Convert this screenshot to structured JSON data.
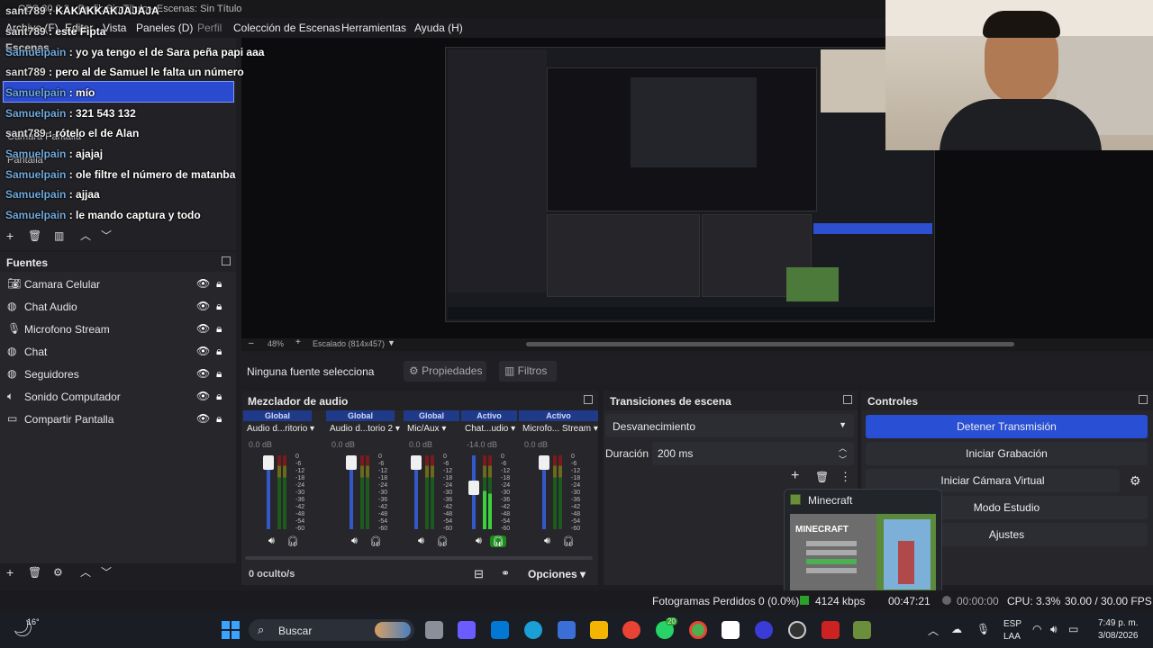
{
  "window": {
    "title": "OBS 30.2.3 - Perfil: Sin Título - Escenas: Sin Título"
  },
  "menu": [
    "Archivo (F)",
    "Editar",
    "Vista",
    "Paneles (D)",
    "Perfil",
    "Colección de Escenas",
    "Herramientas",
    "Ayuda (H)"
  ],
  "chat": [
    {
      "user": "sant789",
      "text": " : KAKAKKAKJAJAJA"
    },
    {
      "user": "sant789",
      "text": " : este Fipta"
    },
    {
      "user": "Samuelpain",
      "text": " : yo ya tengo el de Sara peña papi aaa"
    },
    {
      "user": "sant789",
      "text": " : pero al de Samuel le falta un número"
    },
    {
      "user": "Samuelpain",
      "text": " : mío"
    },
    {
      "user": "Samuelpain",
      "text": " : 321 543 132"
    },
    {
      "user": "sant789",
      "text": " : rótelo el de Alan"
    },
    {
      "user": "Samuelpain",
      "text": " : ajajaj"
    },
    {
      "user": "Samuelpain",
      "text": " : ole filtre el número de matanba"
    },
    {
      "user": "Samuelpain",
      "text": " : ajjaa"
    },
    {
      "user": "Samuelpain",
      "text": " : le mando captura y todo"
    }
  ],
  "scenes": {
    "header": "Escenas",
    "items": [
      "Cámara Pantalla",
      "Pantalla"
    ]
  },
  "sources": {
    "header": "Fuentes",
    "items": [
      {
        "label": "Camara Celular",
        "icon": "camera-icon"
      },
      {
        "label": "Chat Audio",
        "icon": "globe-icon"
      },
      {
        "label": "Microfono Stream",
        "icon": "mic-icon"
      },
      {
        "label": "Chat",
        "icon": "globe-icon"
      },
      {
        "label": "Seguidores",
        "icon": "globe-icon"
      },
      {
        "label": "Sonido Computador",
        "icon": "speaker-icon"
      },
      {
        "label": "Compartir Pantalla",
        "icon": "monitor-icon"
      }
    ]
  },
  "preview": {
    "zoom": "48%",
    "scale": "Escalado (814x457)"
  },
  "props_bar": {
    "no_source": "Ninguna fuente selecciona",
    "properties": "Propiedades",
    "filters": "Filtros"
  },
  "mixer": {
    "header": "Mezclador de audio",
    "channels": [
      {
        "tag": "Global",
        "name": "Audio d...ritorio",
        "db": "0.0 dB",
        "level": 0.95,
        "active": false
      },
      {
        "tag": "Global",
        "name": "Audio d...torio 2",
        "db": "0.0 dB",
        "level": 0.95,
        "active": false
      },
      {
        "tag": "Global",
        "name": "Mic/Aux",
        "db": "0.0 dB",
        "level": 0.95,
        "active": false
      },
      {
        "tag": "Activo",
        "name": "Chat...udio",
        "db": "-14.0 dB",
        "level": 0.55,
        "active": true
      },
      {
        "tag": "Activo",
        "name": "Microfo... Stream",
        "db": "0.0 dB",
        "level": 0.95,
        "active": false
      }
    ],
    "scale": [
      "0",
      "-6",
      "-12",
      "-18",
      "-24",
      "-30",
      "-36",
      "-42",
      "-48",
      "-54",
      "-60"
    ],
    "hidden": "0 oculto/s",
    "options": "Opciones"
  },
  "transitions": {
    "header": "Transiciones de escena",
    "selected": "Desvanecimiento",
    "duration_label": "Duración",
    "duration": "200 ms"
  },
  "controls": {
    "header": "Controles",
    "buttons": [
      "Detener Transmisión",
      "Iniciar Grabación",
      "Iniciar Cámara Virtual",
      "Modo Estudio",
      "Ajustes"
    ]
  },
  "popup": {
    "title": "Minecraft",
    "logo": "MINECRAFT"
  },
  "status": {
    "dropped": "Fotogramas Perdidos 0 (0.0%)",
    "kbps": "4124 kbps",
    "live": "00:47:21",
    "rec": "00:00:00",
    "cpu": "CPU: 3.3%",
    "fps": "30.00 / 30.00 FPS"
  },
  "taskbar": {
    "weather": "16°",
    "search": "Buscar",
    "lang1": "ESP",
    "lang2": "LAA",
    "time": "7:49 p. m.",
    "date": "3/08/2026",
    "badge": "20",
    "colors": [
      "#f5b400",
      "#0078d4",
      "#3aa3ff",
      "#25d366",
      "#ea4335",
      "#6b5cff",
      "#cc2222",
      "#4caf50"
    ]
  }
}
